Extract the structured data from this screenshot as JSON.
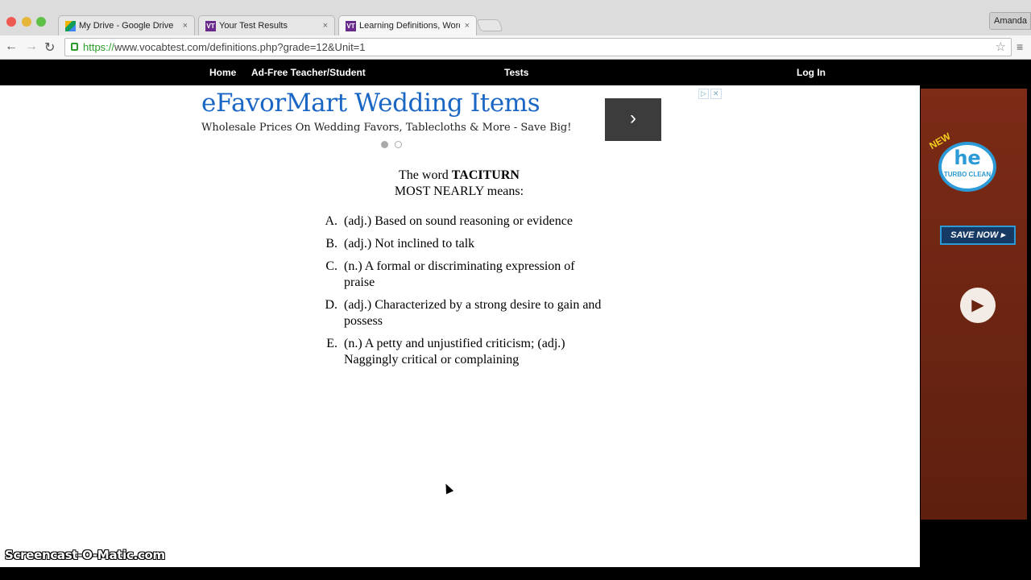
{
  "browser": {
    "tabs": [
      {
        "title": "My Drive - Google Drive",
        "close": "×"
      },
      {
        "title": "Your Test Results",
        "close": "×"
      },
      {
        "title": "Learning Definitions, Word",
        "close": "×"
      }
    ],
    "profile_name": "Amanda",
    "url_protocol": "https://",
    "url_rest": "www.vocabtest.com/definitions.php?grade=12&Unit=1",
    "back_glyph": "←",
    "forward_glyph": "→",
    "reload_glyph": "↻",
    "star_glyph": "☆",
    "menu_glyph": "≡"
  },
  "site_nav": {
    "home": "Home",
    "adfree": "Ad-Free Teacher/Student",
    "tests": "Tests",
    "login": "Log In"
  },
  "ad": {
    "title": "eFavorMart Wedding Items",
    "subtitle": "Wholesale Prices On Wedding Favors, Tablecloths & More - Save Big!",
    "next_glyph": "›",
    "adchoices": "▷",
    "close": "✕"
  },
  "question": {
    "prefix": "The word ",
    "word": "TACITURN",
    "line2": "MOST NEARLY means:"
  },
  "choices": [
    {
      "letter": "A.",
      "text": "(adj.) Based on sound reasoning or evidence"
    },
    {
      "letter": "B.",
      "text": "(adj.) Not inclined to talk"
    },
    {
      "letter": "C.",
      "text": "(n.) A formal or discriminating expression of praise"
    },
    {
      "letter": "D.",
      "text": "(adj.) Characterized by a strong desire to gain and possess"
    },
    {
      "letter": "E.",
      "text": "(n.) A petty and unjustified criticism; (adj.) Naggingly critical or complaining"
    }
  ],
  "side_ad": {
    "new_label": "NEW",
    "logo_he": "he",
    "logo_sub": "TURBO CLEAN",
    "save_now": "SAVE NOW ▸",
    "play_glyph": "▶"
  },
  "watermark": "Screencast-O-Matic.com",
  "colors": {
    "link_blue": "#1a66c4",
    "nav_bg": "#000000",
    "side_ad_bg": "#6a2412",
    "secure_green": "#2a9d2a"
  }
}
